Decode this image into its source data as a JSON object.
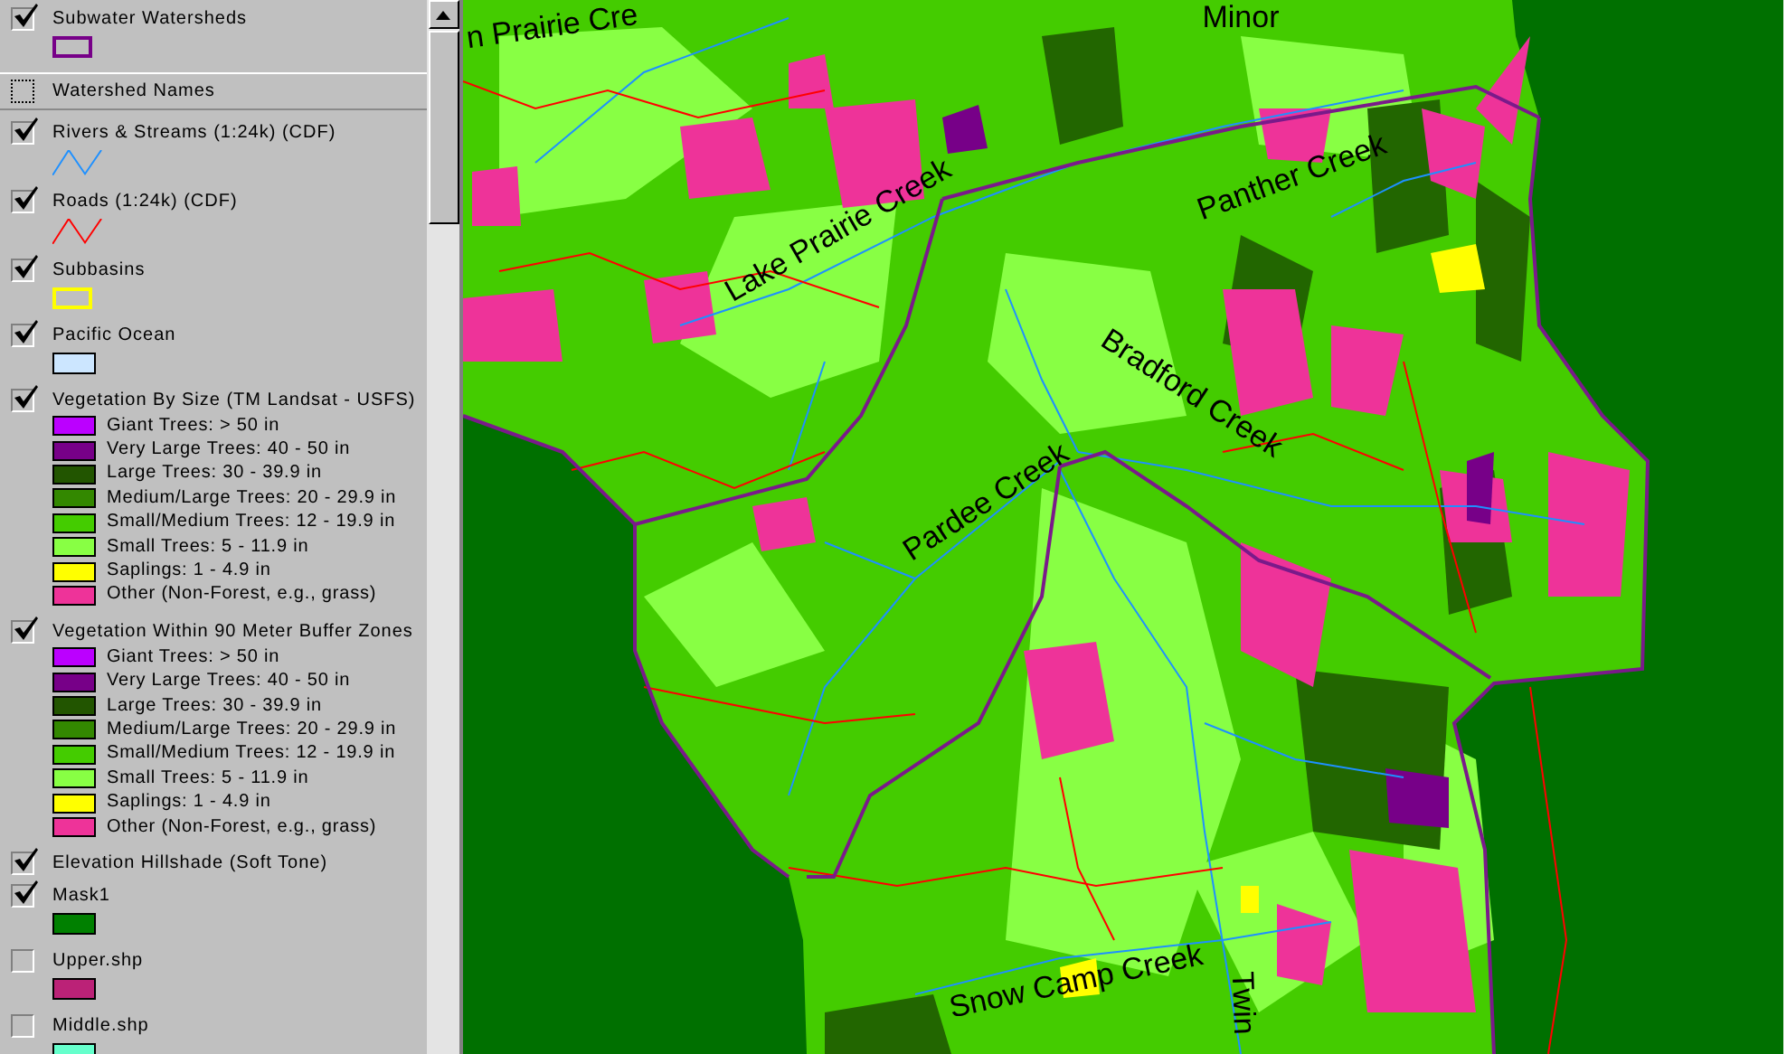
{
  "legend": {
    "layers": [
      {
        "label": "Subwater Watersheds",
        "checked": true,
        "selected": false,
        "kind": "outline",
        "color": "#770088"
      },
      {
        "label": "Watershed Names",
        "checked": false,
        "selected": true,
        "kind": "none"
      },
      {
        "label": "Rivers & Streams (1:24k) (CDF)",
        "checked": true,
        "selected": false,
        "kind": "line",
        "color": "#1e90ff"
      },
      {
        "label": "Roads (1:24k) (CDF)",
        "checked": true,
        "selected": false,
        "kind": "line",
        "color": "#ff0000"
      },
      {
        "label": "Subbasins",
        "checked": true,
        "selected": false,
        "kind": "outline",
        "color": "#ffff00"
      },
      {
        "label": "Pacific Ocean",
        "checked": true,
        "selected": false,
        "kind": "fill",
        "color": "#cce6ff"
      },
      {
        "label": "Vegetation By Size (TM Landsat - USFS)",
        "checked": true,
        "selected": false,
        "kind": "classes",
        "classes": [
          {
            "label": "Giant Trees: > 50 in",
            "color": "#bb00ff"
          },
          {
            "label": "Very Large Trees: 40 - 50 in",
            "color": "#770088"
          },
          {
            "label": "Large Trees: 30 - 39.9 in",
            "color": "#225500"
          },
          {
            "label": "Medium/Large Trees: 20 - 29.9 in",
            "color": "#338800"
          },
          {
            "label": "Small/Medium Trees: 12 - 19.9 in",
            "color": "#44cc00"
          },
          {
            "label": "Small Trees: 5 - 11.9 in",
            "color": "#88ff44"
          },
          {
            "label": "Saplings: 1 - 4.9 in",
            "color": "#ffff00"
          },
          {
            "label": "Other (Non-Forest, e.g., grass)",
            "color": "#ee3399"
          }
        ]
      },
      {
        "label": "Vegetation Within 90 Meter Buffer Zones",
        "checked": true,
        "selected": false,
        "kind": "classes",
        "classes": [
          {
            "label": "Giant Trees: > 50 in",
            "color": "#bb00ff"
          },
          {
            "label": "Very Large Trees: 40 - 50 in",
            "color": "#770088"
          },
          {
            "label": "Large Trees: 30 - 39.9 in",
            "color": "#225500"
          },
          {
            "label": "Medium/Large Trees: 20 - 29.9 in",
            "color": "#338800"
          },
          {
            "label": "Small/Medium Trees: 12 - 19.9 in",
            "color": "#44cc00"
          },
          {
            "label": "Small Trees: 5 - 11.9 in",
            "color": "#88ff44"
          },
          {
            "label": "Saplings: 1 - 4.9 in",
            "color": "#ffff00"
          },
          {
            "label": "Other (Non-Forest, e.g., grass)",
            "color": "#ee3399"
          }
        ]
      },
      {
        "label": "Elevation Hillshade (Soft Tone)",
        "checked": true,
        "selected": false,
        "kind": "none"
      },
      {
        "label": "Mask1",
        "checked": true,
        "selected": false,
        "kind": "fill",
        "color": "#008000"
      },
      {
        "label": "Upper.shp",
        "checked": false,
        "selected": false,
        "kind": "fill",
        "color": "#bb2277"
      },
      {
        "label": "Middle.shp",
        "checked": false,
        "selected": false,
        "kind": "fill",
        "color": "#66ffcc"
      }
    ]
  },
  "map": {
    "labels": [
      "n Prairie Cre",
      "Minor",
      "Lake Prairie Creek",
      "Panther Creek",
      "Bradford Creek",
      "Pardee Creek",
      "Snow Camp Creek",
      "Twin"
    ]
  }
}
